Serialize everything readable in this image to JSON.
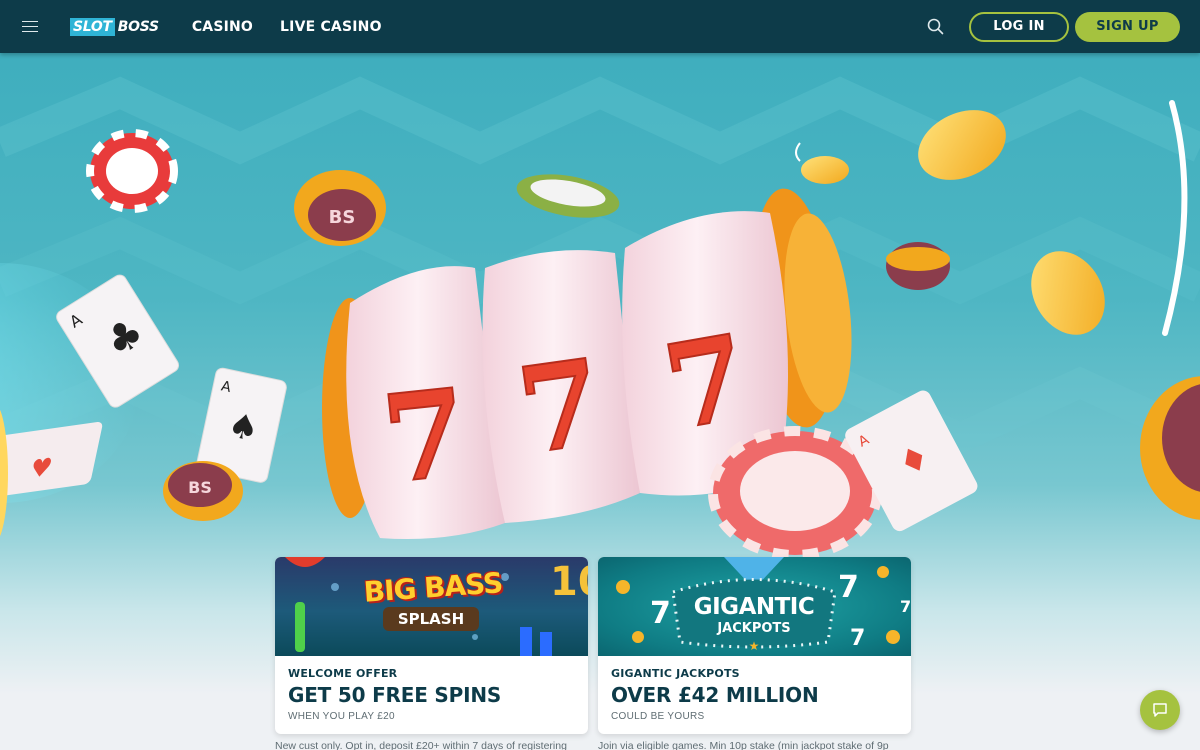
{
  "header": {
    "logo_part1": "SLOT",
    "logo_part2": "BOSS",
    "nav": [
      {
        "label": "CASINO"
      },
      {
        "label": "LIVE CASINO"
      }
    ],
    "login_label": "LOG IN",
    "signup_label": "SIGN UP"
  },
  "hero": {
    "reel_symbols": [
      "7",
      "7",
      "7"
    ],
    "chip_text": "BS"
  },
  "promos": [
    {
      "banner_title": "BIG BASS",
      "banner_subtitle": "SPLASH",
      "kicker": "WELCOME OFFER",
      "headline": "GET 50 FREE SPINS",
      "sub": "WHEN YOU PLAY £20",
      "terms": "New cust only. Opt in, deposit £20+ within 7 days of registering"
    },
    {
      "banner_title": "GIGANTIC",
      "banner_subtitle": "JACKPOTS",
      "kicker": "GIGANTIC JACKPOTS",
      "headline": "OVER £42 MILLION",
      "sub": "COULD BE YOURS",
      "terms": "Join via eligible games. Min 10p stake (min jackpot stake of 9p"
    }
  ],
  "colors": {
    "header_bg": "#0d3b49",
    "accent_green": "#a5c23f",
    "logo_blue": "#2fb4d6",
    "hero_teal": "#4eb6c3"
  },
  "icons": {
    "menu": "hamburger-icon",
    "search": "search-icon",
    "chat": "chat-icon"
  }
}
